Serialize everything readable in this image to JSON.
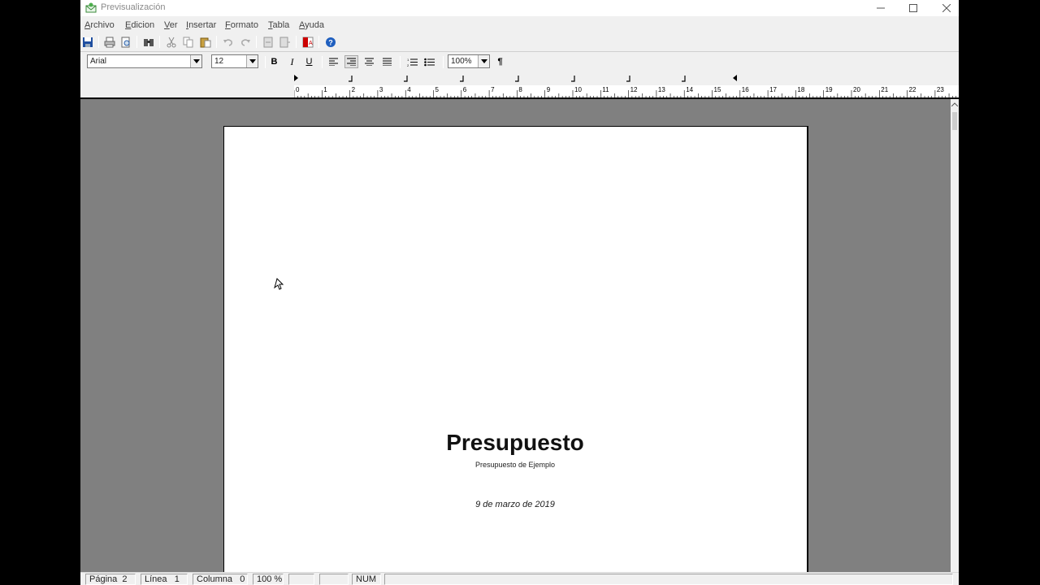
{
  "window": {
    "title": "Previsualización"
  },
  "menu": {
    "items": [
      {
        "key": "A",
        "rest": "rchivo"
      },
      {
        "key": "E",
        "rest": "dicion"
      },
      {
        "key": "V",
        "rest": "er"
      },
      {
        "key": "I",
        "rest": "nsertar"
      },
      {
        "key": "F",
        "rest": "ormato"
      },
      {
        "key": "T",
        "rest": "abla"
      },
      {
        "key": "A",
        "rest": "yuda"
      }
    ]
  },
  "format_toolbar": {
    "font_name": "Arial",
    "font_size": "12",
    "bold_label": "B",
    "italic_label": "I",
    "underline_label": "U",
    "zoom": "100%",
    "paragraph_mark": "¶"
  },
  "ruler": {
    "labels": [
      "0",
      "1",
      "2",
      "3",
      "4",
      "5",
      "6",
      "7",
      "8",
      "9",
      "10",
      "11",
      "12",
      "13",
      "14",
      "15",
      "16",
      "17",
      "18",
      "19",
      "20",
      "21",
      "22",
      "23"
    ]
  },
  "document": {
    "title": "Presupuesto",
    "subtitle": "Presupuesto de Ejemplo",
    "date": "9 de marzo de 2019"
  },
  "status": {
    "page_label": "Página",
    "page_value": "2",
    "line_label": "Línea",
    "line_value": "1",
    "column_label": "Columna",
    "column_value": "0",
    "zoom": "100 %",
    "num": "NUM"
  },
  "colors": {
    "workspace": "#808080",
    "chrome": "#f0f0f0",
    "page": "#ffffff"
  }
}
